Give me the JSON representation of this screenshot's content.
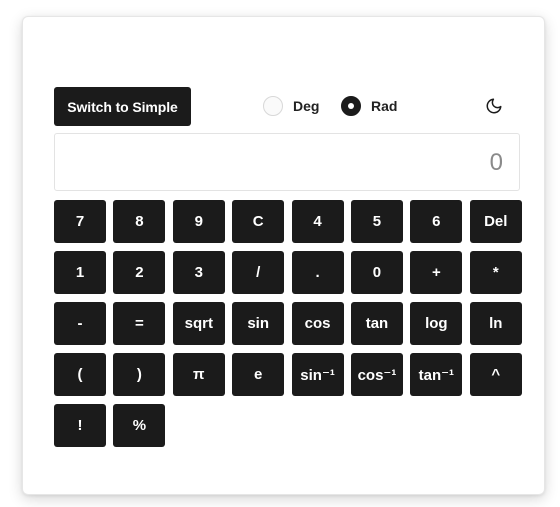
{
  "header": {
    "switch_label": "Switch to Simple",
    "angle_modes": [
      {
        "label": "Deg",
        "selected": false
      },
      {
        "label": "Rad",
        "selected": true
      }
    ],
    "theme_icon": "moon-icon"
  },
  "display": {
    "value": "0"
  },
  "keys": [
    "7",
    "8",
    "9",
    "C",
    "4",
    "5",
    "6",
    "Del",
    "1",
    "2",
    "3",
    "/",
    ".",
    "0",
    "+",
    "*",
    "-",
    "=",
    "sqrt",
    "sin",
    "cos",
    "tan",
    "log",
    "ln",
    "(",
    ")",
    "π",
    "e",
    "sin⁻¹",
    "cos⁻¹",
    "tan⁻¹",
    "^",
    "!",
    "%"
  ],
  "colors": {
    "button_bg": "#1b1b1b",
    "button_text": "#ffffff",
    "display_text": "#8a8a8a"
  }
}
